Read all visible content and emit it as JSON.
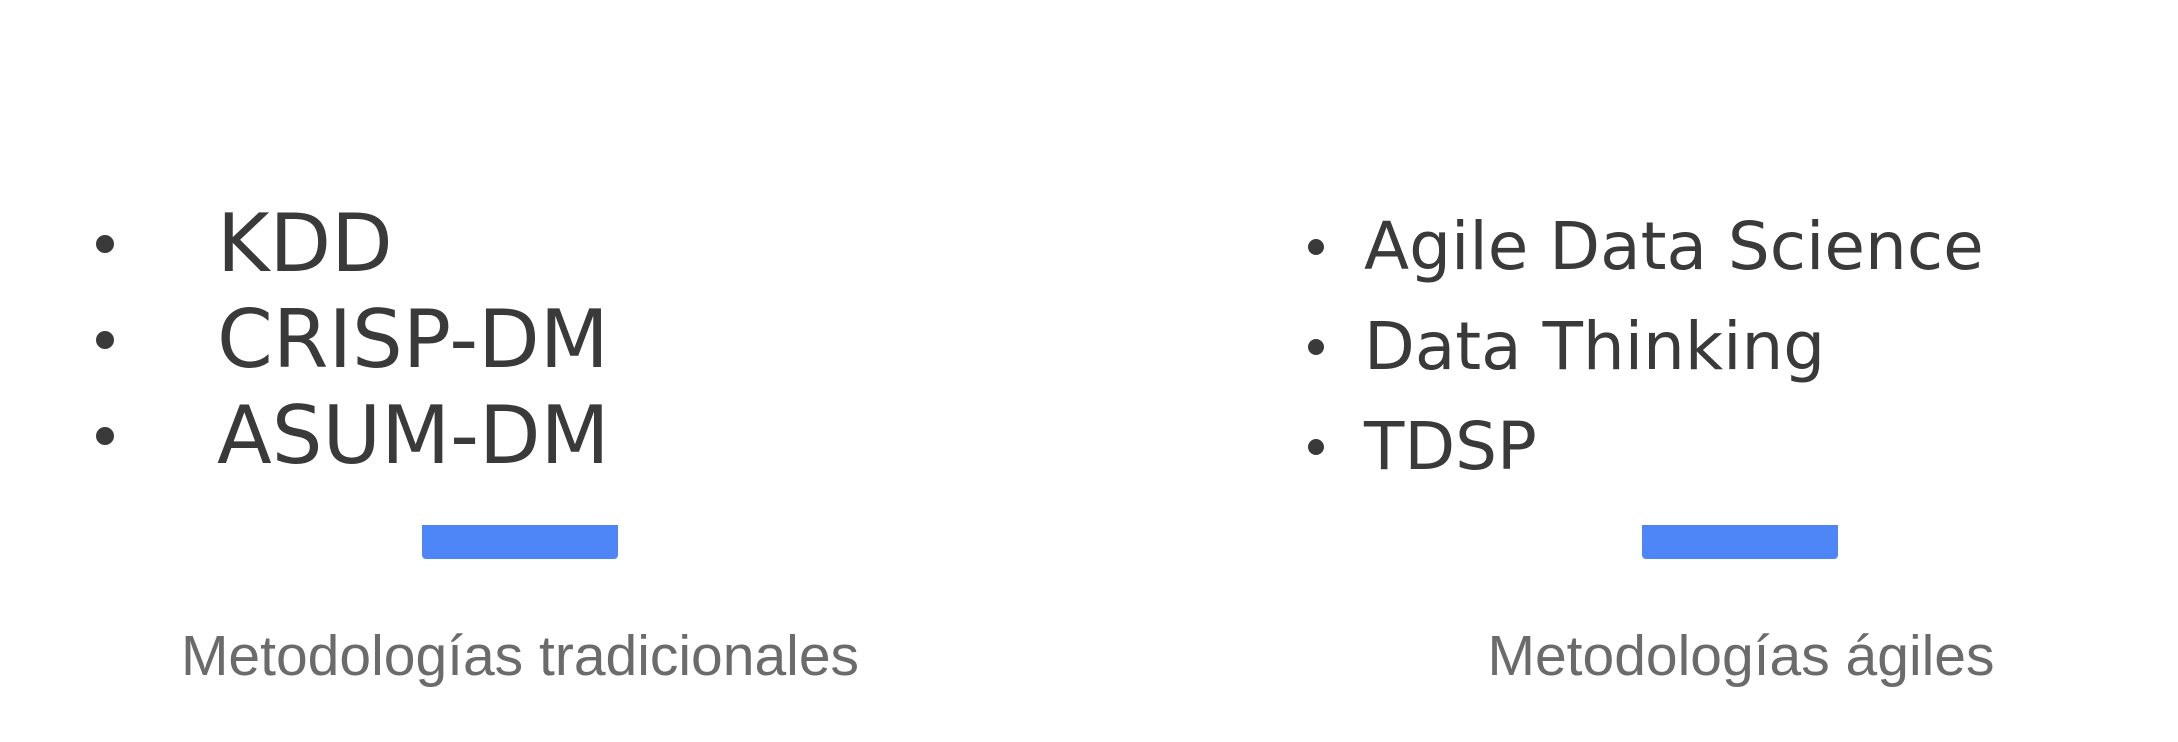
{
  "colors": {
    "text": "#3a3a3a",
    "caption": "#6b6b6b",
    "accent": "#4f86f7",
    "background": "#ffffff"
  },
  "left_column": {
    "items": [
      {
        "label": "KDD"
      },
      {
        "label": "CRISP-DM"
      },
      {
        "label": "ASUM-DM"
      }
    ],
    "caption": "Metodologías tradicionales"
  },
  "right_column": {
    "items": [
      {
        "label": "Agile Data Science"
      },
      {
        "label": "Data Thinking"
      },
      {
        "label": "TDSP"
      }
    ],
    "caption": "Metodologías ágiles"
  }
}
